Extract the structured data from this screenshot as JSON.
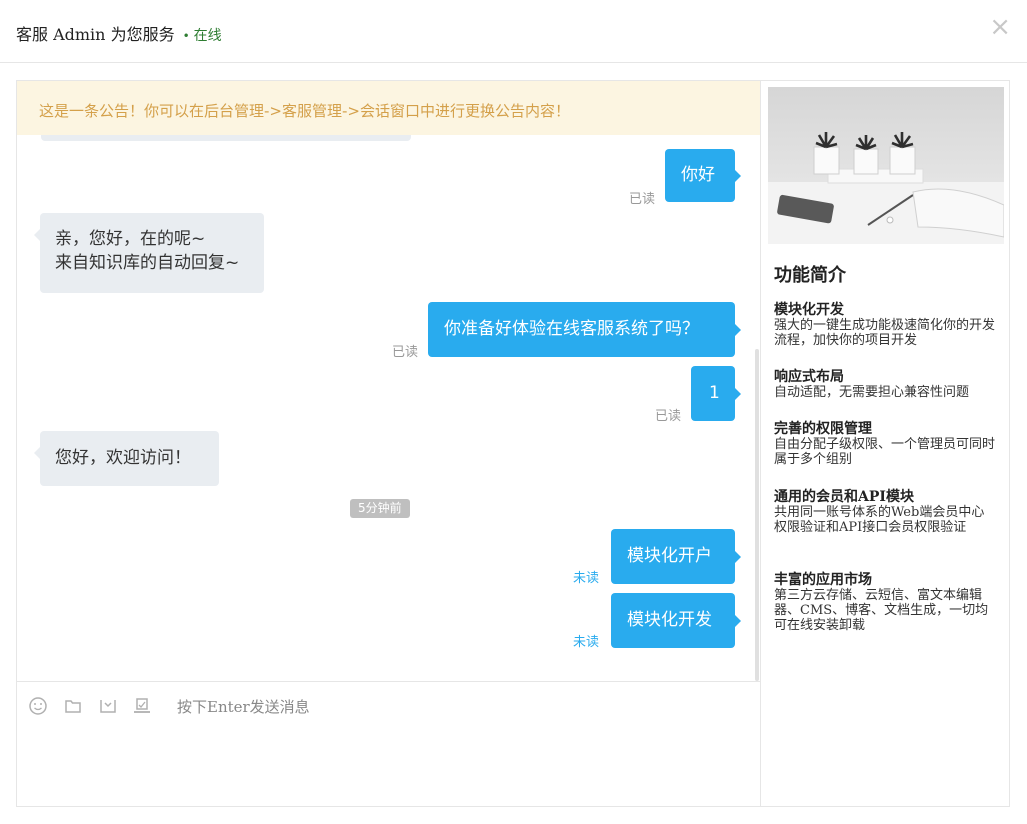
{
  "header": {
    "title": "客服 Admin 为您服务",
    "dot": "•",
    "status": "在线",
    "close": "×"
  },
  "notice": "这是一条公告！你可以在后台管理->客服管理->会话窗口中进行更换公告内容！",
  "messages": [
    {
      "side": "right",
      "text": "你好",
      "receipt": "已读"
    },
    {
      "side": "left",
      "line1": "亲，您好，在的呢~",
      "line2": "来自知识库的自动回复~"
    },
    {
      "side": "right",
      "text": "你准备好体验在线客服系统了吗？",
      "receipt": "已读"
    },
    {
      "side": "right",
      "text": "1",
      "receipt": "已读"
    },
    {
      "side": "left",
      "text": "您好，欢迎访问！"
    },
    {
      "side": "right",
      "text": "模块化开户",
      "receipt": "未读"
    },
    {
      "side": "right",
      "text": "模块化开发",
      "receipt": "未读"
    }
  ],
  "time_tag": "5分钟前",
  "input": {
    "placeholder": "按下Enter发送消息"
  },
  "side": {
    "title": "功能简介",
    "features": [
      {
        "title": "模块化开发",
        "desc": "强大的一键生成功能极速简化你的开发流程，加快你的项目开发"
      },
      {
        "title": "响应式布局",
        "desc": "自动适配，无需要担心兼容性问题"
      },
      {
        "title": "完善的权限管理",
        "desc": "自由分配子级权限、一个管理员可同时属于多个组别"
      },
      {
        "title": "通用的会员和API模块",
        "desc": "共用同一账号体系的Web端会员中心权限验证和API接口会员权限验证"
      },
      {
        "title": "丰富的应用市场",
        "desc": "第三方云存储、云短信、富文本编辑器、CMS、博客、文档生成，一切均可在线安装卸载"
      }
    ]
  },
  "colors": {
    "accent": "#29abee",
    "notice_bg": "#fcf5e1",
    "notice_text": "#d4a04a",
    "online": "#2e7d32"
  }
}
